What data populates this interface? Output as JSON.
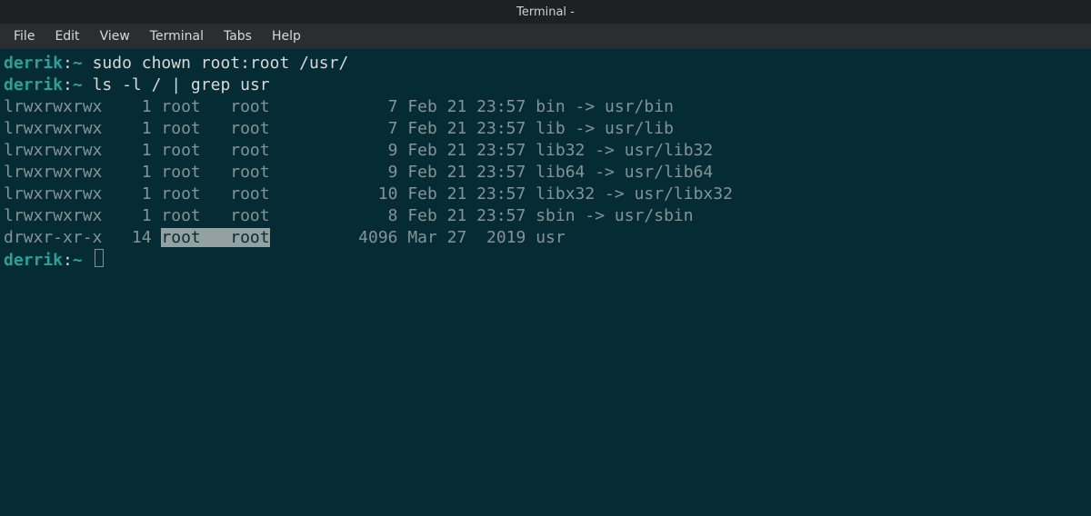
{
  "window": {
    "title": "Terminal -"
  },
  "menu": {
    "items": [
      "File",
      "Edit",
      "View",
      "Terminal",
      "Tabs",
      "Help"
    ]
  },
  "session": {
    "prompt_user": "derrik",
    "prompt_path": "~",
    "commands": [
      "sudo chown root:root /usr/",
      "ls -l / | grep usr"
    ],
    "output": [
      {
        "perm": "lrwxrwxrwx",
        "links": "1",
        "owner": "root",
        "group": "root",
        "size": "7",
        "date": "Feb 21 23:57",
        "name": "bin -> usr/bin",
        "highlight": false
      },
      {
        "perm": "lrwxrwxrwx",
        "links": "1",
        "owner": "root",
        "group": "root",
        "size": "7",
        "date": "Feb 21 23:57",
        "name": "lib -> usr/lib",
        "highlight": false
      },
      {
        "perm": "lrwxrwxrwx",
        "links": "1",
        "owner": "root",
        "group": "root",
        "size": "9",
        "date": "Feb 21 23:57",
        "name": "lib32 -> usr/lib32",
        "highlight": false
      },
      {
        "perm": "lrwxrwxrwx",
        "links": "1",
        "owner": "root",
        "group": "root",
        "size": "9",
        "date": "Feb 21 23:57",
        "name": "lib64 -> usr/lib64",
        "highlight": false
      },
      {
        "perm": "lrwxrwxrwx",
        "links": "1",
        "owner": "root",
        "group": "root",
        "size": "10",
        "date": "Feb 21 23:57",
        "name": "libx32 -> usr/libx32",
        "highlight": false
      },
      {
        "perm": "lrwxrwxrwx",
        "links": "1",
        "owner": "root",
        "group": "root",
        "size": "8",
        "date": "Feb 21 23:57",
        "name": "sbin -> usr/sbin",
        "highlight": false
      },
      {
        "perm": "drwxr-xr-x",
        "links": "14",
        "owner": "root",
        "group": "root",
        "size": "4096",
        "date": "Mar 27  2019",
        "name": "usr",
        "highlight": true
      }
    ]
  }
}
